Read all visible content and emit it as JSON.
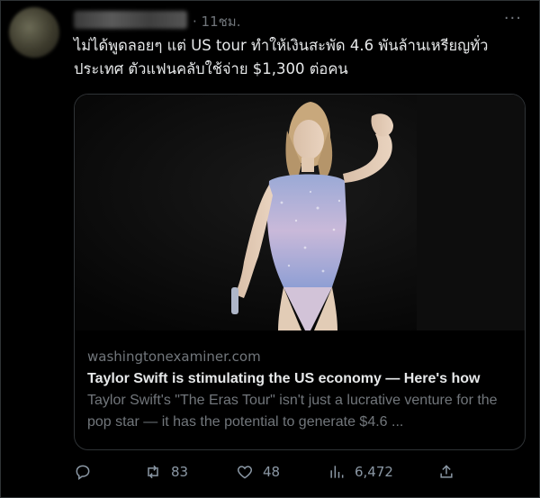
{
  "tweet": {
    "time": "· 11ชม.",
    "text": "ไม่ได้พูดลอยๆ แต่ US tour ทำให้เงินสะพัด 4.6 พันล้านเหรียญทั่วประเทศ ตัวแฟนคลับใช้จ่าย $1,300 ต่อคน"
  },
  "card": {
    "domain": "washingtonexaminer.com",
    "headline": "Taylor Swift is stimulating the US economy — Here's how",
    "description": "Taylor Swift's \"The Eras Tour\" isn't just a lucrative venture for the pop star — it has the potential to generate $4.6 ..."
  },
  "actions": {
    "retweets": "83",
    "likes": "48",
    "views": "6,472"
  },
  "icons": [
    "more-icon",
    "reply-icon",
    "retweet-icon",
    "like-icon",
    "views-icon",
    "share-icon"
  ],
  "colors": {
    "background": "#000000",
    "text": "#e7e9ea",
    "muted": "#71767b",
    "border": "#2f3336"
  }
}
